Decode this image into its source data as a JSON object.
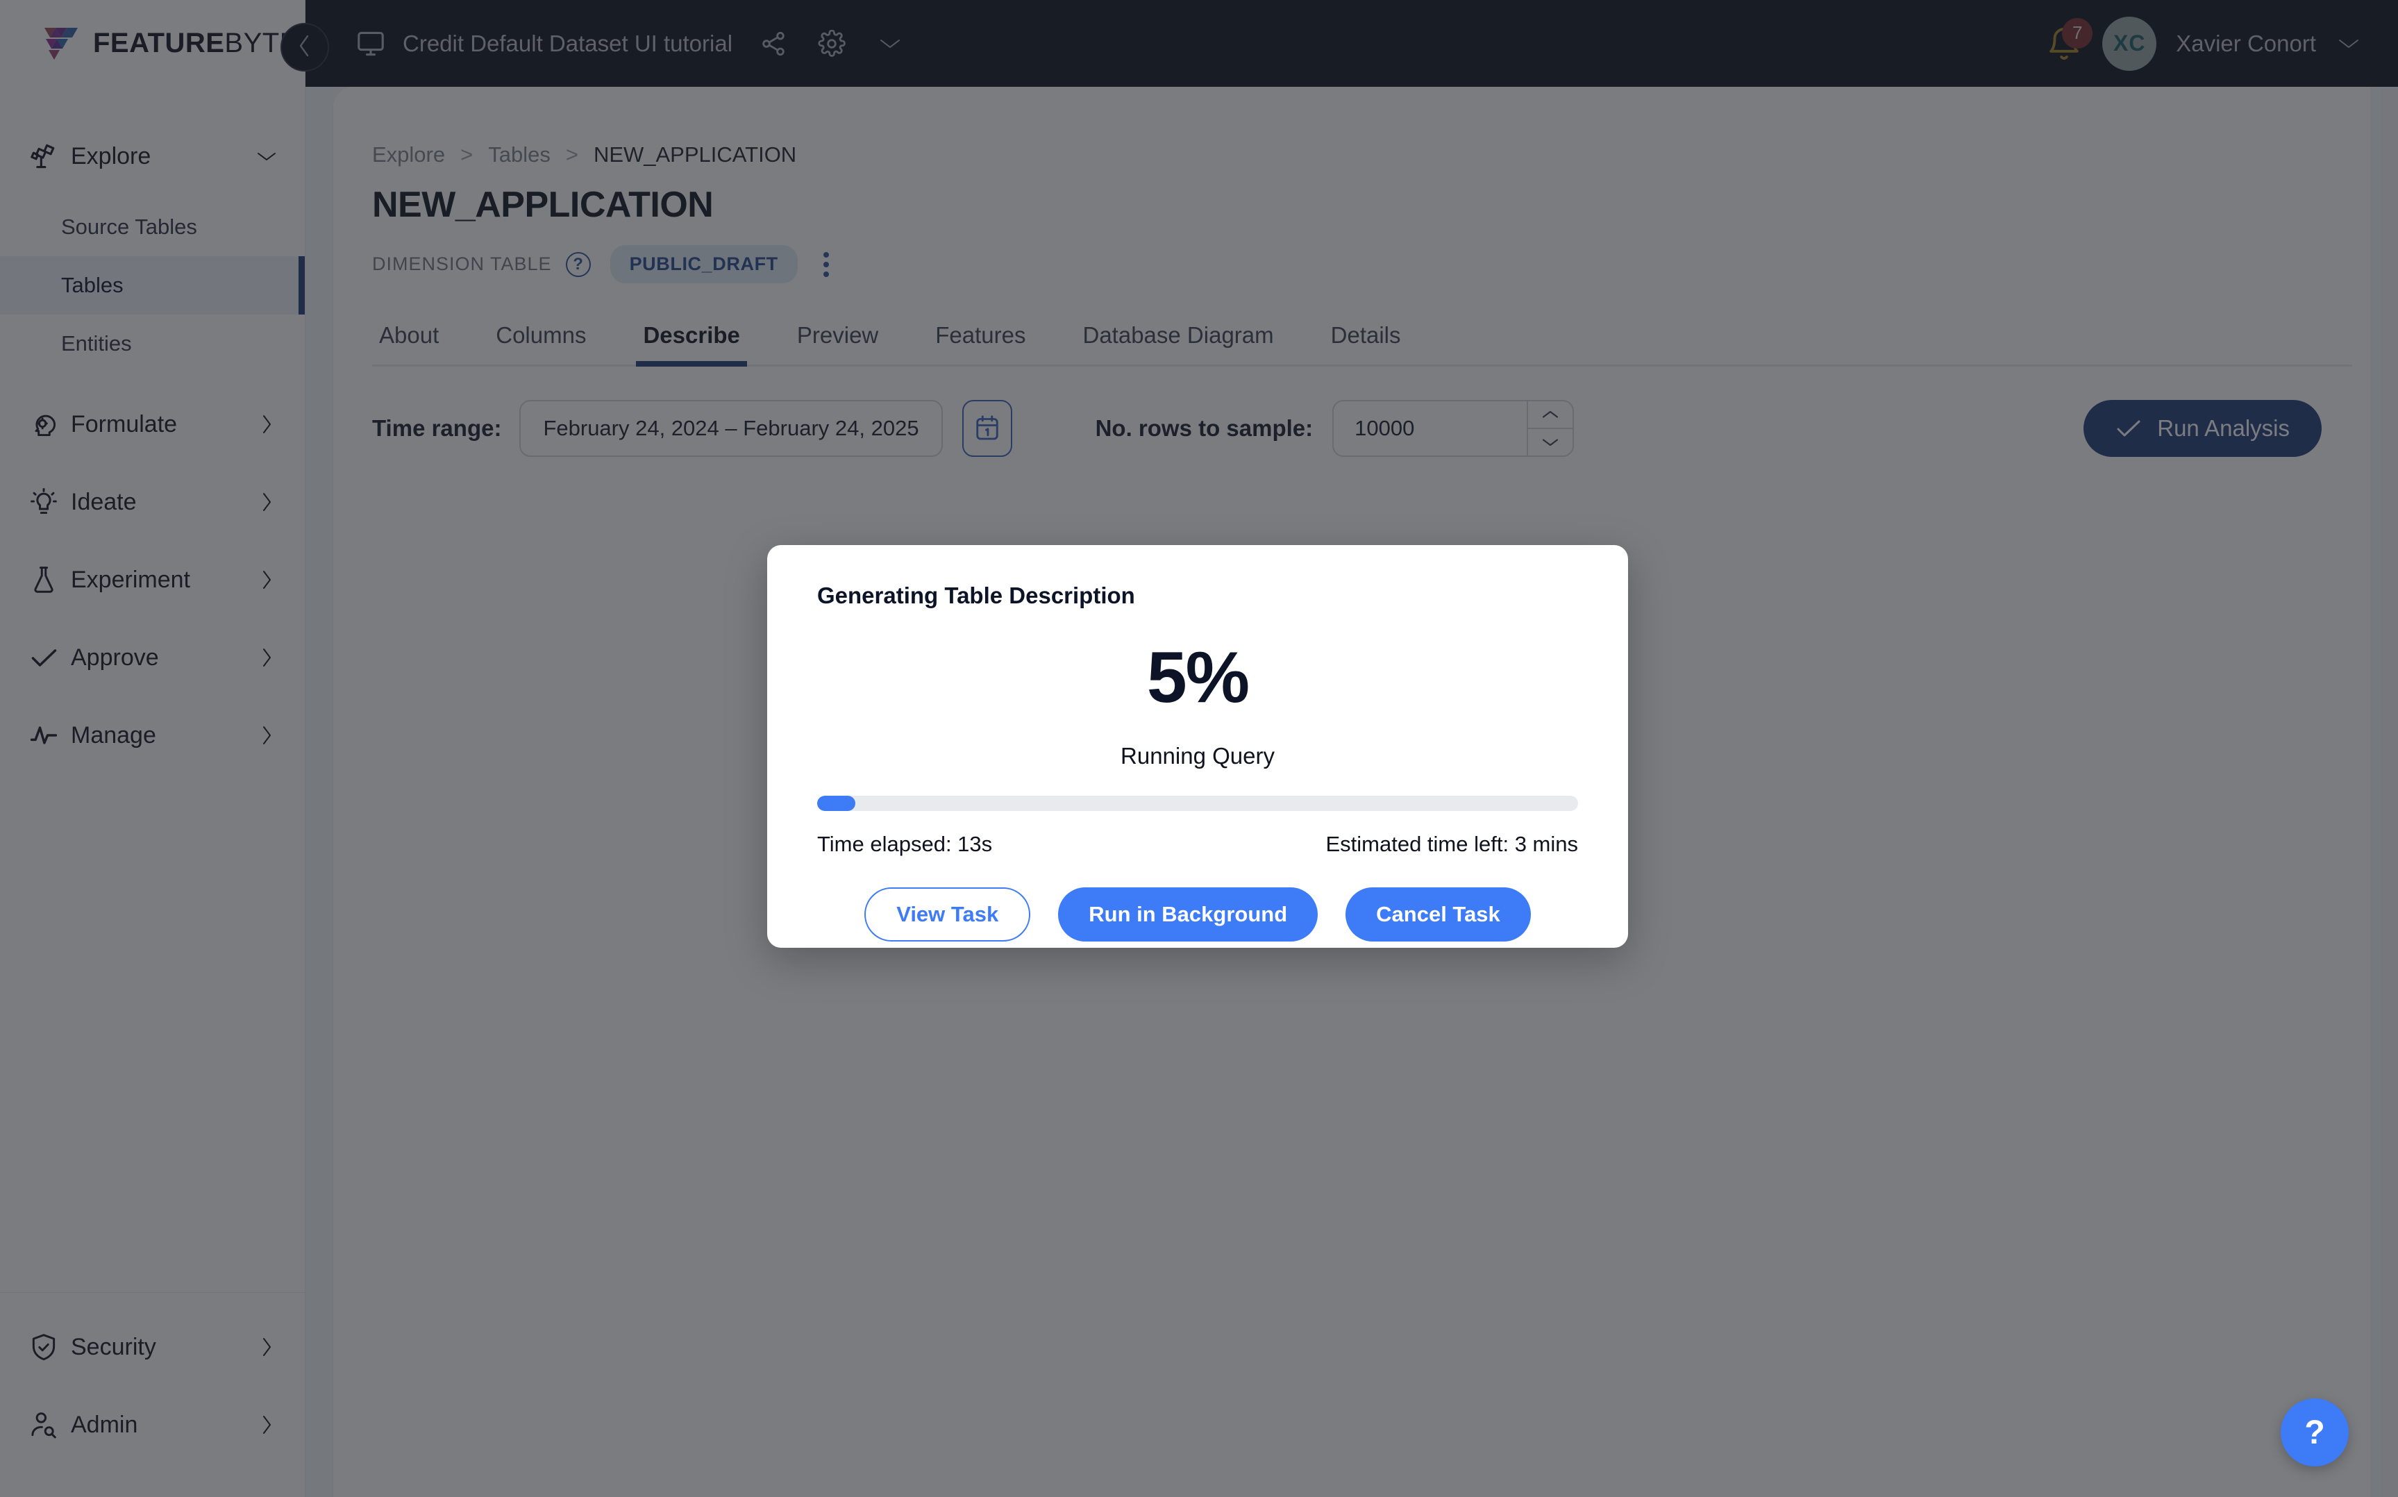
{
  "brand": {
    "name_bold": "FEATURE",
    "name_light": "BYTE",
    "logo_colors": [
      "#8e3a5c",
      "#5b2d91",
      "#2d5fa8",
      "#a03f5e",
      "#7a3a9e",
      "#3a6fb5"
    ]
  },
  "topbar": {
    "monitor_icon": "monitor-icon",
    "workspace_title": "Credit Default Dataset UI tutorial",
    "share_icon": "share-icon",
    "settings_icon": "gear-icon",
    "workspace_chevron_icon": "chevron-down-icon",
    "collapse_icon": "chevron-left-icon",
    "bell_icon": "bell-icon",
    "notification_count": "7",
    "avatar_initials": "XC",
    "user_name": "Xavier Conort",
    "user_chevron_icon": "chevron-down-icon",
    "bg_color": "#0c0f1c"
  },
  "sidebar": {
    "groups": [
      {
        "label": "Explore",
        "icon": "telescope-icon",
        "chevron": "chevron-down-icon",
        "expanded": true,
        "children": [
          {
            "label": "Source Tables",
            "active": false
          },
          {
            "label": "Tables",
            "active": true
          },
          {
            "label": "Entities",
            "active": false
          }
        ]
      },
      {
        "label": "Formulate",
        "icon": "head-gear-icon",
        "chevron": "chevron-right-icon",
        "expanded": false,
        "children": []
      },
      {
        "label": "Ideate",
        "icon": "lightbulb-icon",
        "chevron": "chevron-right-icon",
        "expanded": false,
        "children": []
      },
      {
        "label": "Experiment",
        "icon": "flask-icon",
        "chevron": "chevron-right-icon",
        "expanded": false,
        "children": []
      },
      {
        "label": "Approve",
        "icon": "check-icon",
        "chevron": "chevron-right-icon",
        "expanded": false,
        "children": []
      },
      {
        "label": "Manage",
        "icon": "pulse-icon",
        "chevron": "chevron-right-icon",
        "expanded": false,
        "children": []
      }
    ],
    "bottom_groups": [
      {
        "label": "Security",
        "icon": "shield-check-icon",
        "chevron": "chevron-right-icon"
      },
      {
        "label": "Admin",
        "icon": "user-search-icon",
        "chevron": "chevron-right-icon"
      }
    ],
    "active_accent": "#1f3a76"
  },
  "breadcrumb": {
    "items": [
      "Explore",
      "Tables",
      "NEW_APPLICATION"
    ],
    "separator": ">"
  },
  "page": {
    "title": "NEW_APPLICATION",
    "table_kind": "DIMENSION TABLE",
    "help_icon": "question-circle-icon",
    "status_badge": "PUBLIC_DRAFT",
    "more_icon": "more-vertical-icon"
  },
  "tabs": [
    {
      "label": "About",
      "active": false
    },
    {
      "label": "Columns",
      "active": false
    },
    {
      "label": "Describe",
      "active": true
    },
    {
      "label": "Preview",
      "active": false
    },
    {
      "label": "Features",
      "active": false
    },
    {
      "label": "Database Diagram",
      "active": false
    },
    {
      "label": "Details",
      "active": false
    }
  ],
  "toolbar": {
    "time_range_label": "Time range:",
    "time_range_value": "February 24, 2024 – February 24, 2025",
    "calendar_icon": "calendar-icon",
    "rows_label": "No. rows to sample:",
    "rows_value": "10000",
    "stepper_up_icon": "chevron-up-icon",
    "stepper_down_icon": "chevron-down-icon",
    "run_button_label": "Run Analysis",
    "run_button_icon": "check-icon",
    "run_button_color": "#1f3a76"
  },
  "modal": {
    "title": "Generating Table Description",
    "percent_text": "5%",
    "percent_value": 5,
    "status": "Running Query",
    "time_elapsed": "Time elapsed: 13s",
    "time_left": "Estimated time left: 3 mins",
    "progress_color": "#3d7bf7",
    "buttons": [
      {
        "label": "View Task",
        "style": "outline"
      },
      {
        "label": "Run in Background",
        "style": "solid"
      },
      {
        "label": "Cancel Task",
        "style": "solid"
      }
    ]
  },
  "fab": {
    "icon": "question-mark-icon",
    "label": "?",
    "color": "#3d7bf7"
  }
}
